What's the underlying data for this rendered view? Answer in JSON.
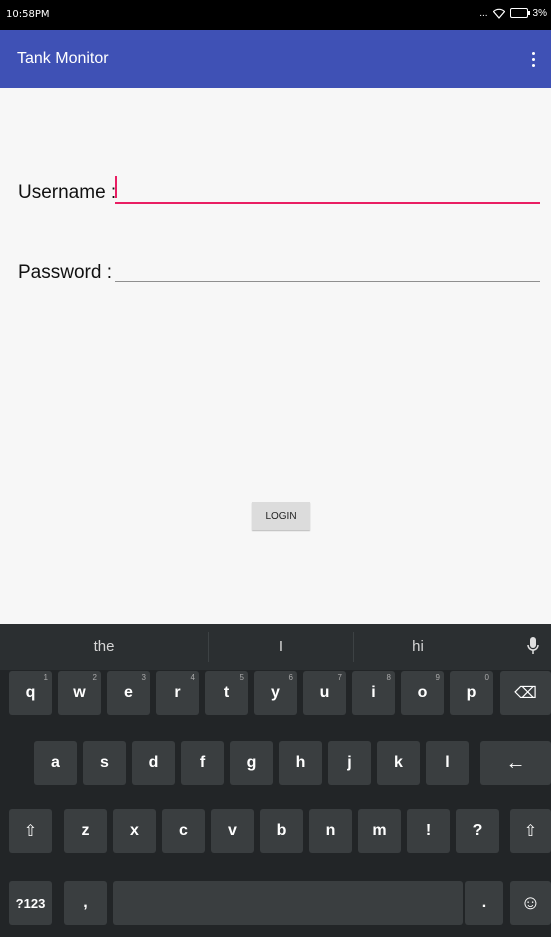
{
  "status": {
    "time": "10:58PM",
    "right_text": "...",
    "battery": "3%"
  },
  "app": {
    "title": "Tank Monitor"
  },
  "form": {
    "username_label": "Username :",
    "password_label": "Password :",
    "username_value": "",
    "password_value": "",
    "login_label": "LOGIN"
  },
  "keyboard": {
    "suggestions": [
      "the",
      "I",
      "hi"
    ],
    "row1": [
      {
        "k": "q",
        "h": "1"
      },
      {
        "k": "w",
        "h": "2"
      },
      {
        "k": "e",
        "h": "3"
      },
      {
        "k": "r",
        "h": "4"
      },
      {
        "k": "t",
        "h": "5"
      },
      {
        "k": "y",
        "h": "6"
      },
      {
        "k": "u",
        "h": "7"
      },
      {
        "k": "i",
        "h": "8"
      },
      {
        "k": "o",
        "h": "9"
      },
      {
        "k": "p",
        "h": "0"
      }
    ],
    "row2": [
      "a",
      "s",
      "d",
      "f",
      "g",
      "h",
      "j",
      "k",
      "l"
    ],
    "row3": [
      "z",
      "x",
      "c",
      "v",
      "b",
      "n",
      "m",
      "!",
      "?"
    ],
    "symbols_label": "?123",
    "comma_label": ",",
    "period_label": ".",
    "shift_glyph": "⇧",
    "backspace_glyph": "⌫",
    "enter_glyph": "←",
    "emoji_glyph": "☺"
  }
}
